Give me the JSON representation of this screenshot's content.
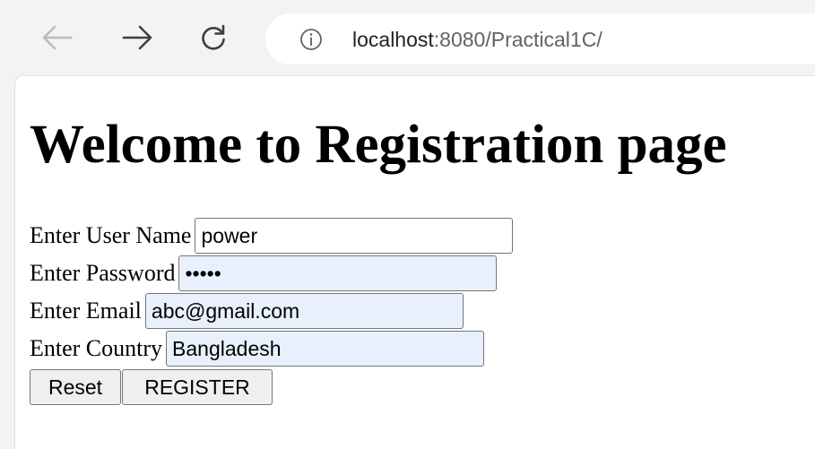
{
  "browser": {
    "url_host": "localhost",
    "url_rest": ":8080/Practical1C/",
    "icons": {
      "back": "arrow-left-icon",
      "forward": "arrow-right-icon",
      "reload": "reload-icon",
      "site_info": "info-circle-icon"
    }
  },
  "page": {
    "heading": "Welcome to Registration page",
    "form": {
      "username": {
        "label": "Enter User Name",
        "value": "power"
      },
      "password": {
        "label": "Enter Password",
        "value": "•••••"
      },
      "email": {
        "label": "Enter Email",
        "value": "abc@gmail.com"
      },
      "country": {
        "label": "Enter Country",
        "value": "Bangladesh"
      },
      "reset_label": "Reset",
      "register_label": "REGISTER"
    }
  },
  "colors": {
    "toolbar_bg": "#f1f3f4",
    "autofill_bg": "#e8f0fe"
  }
}
